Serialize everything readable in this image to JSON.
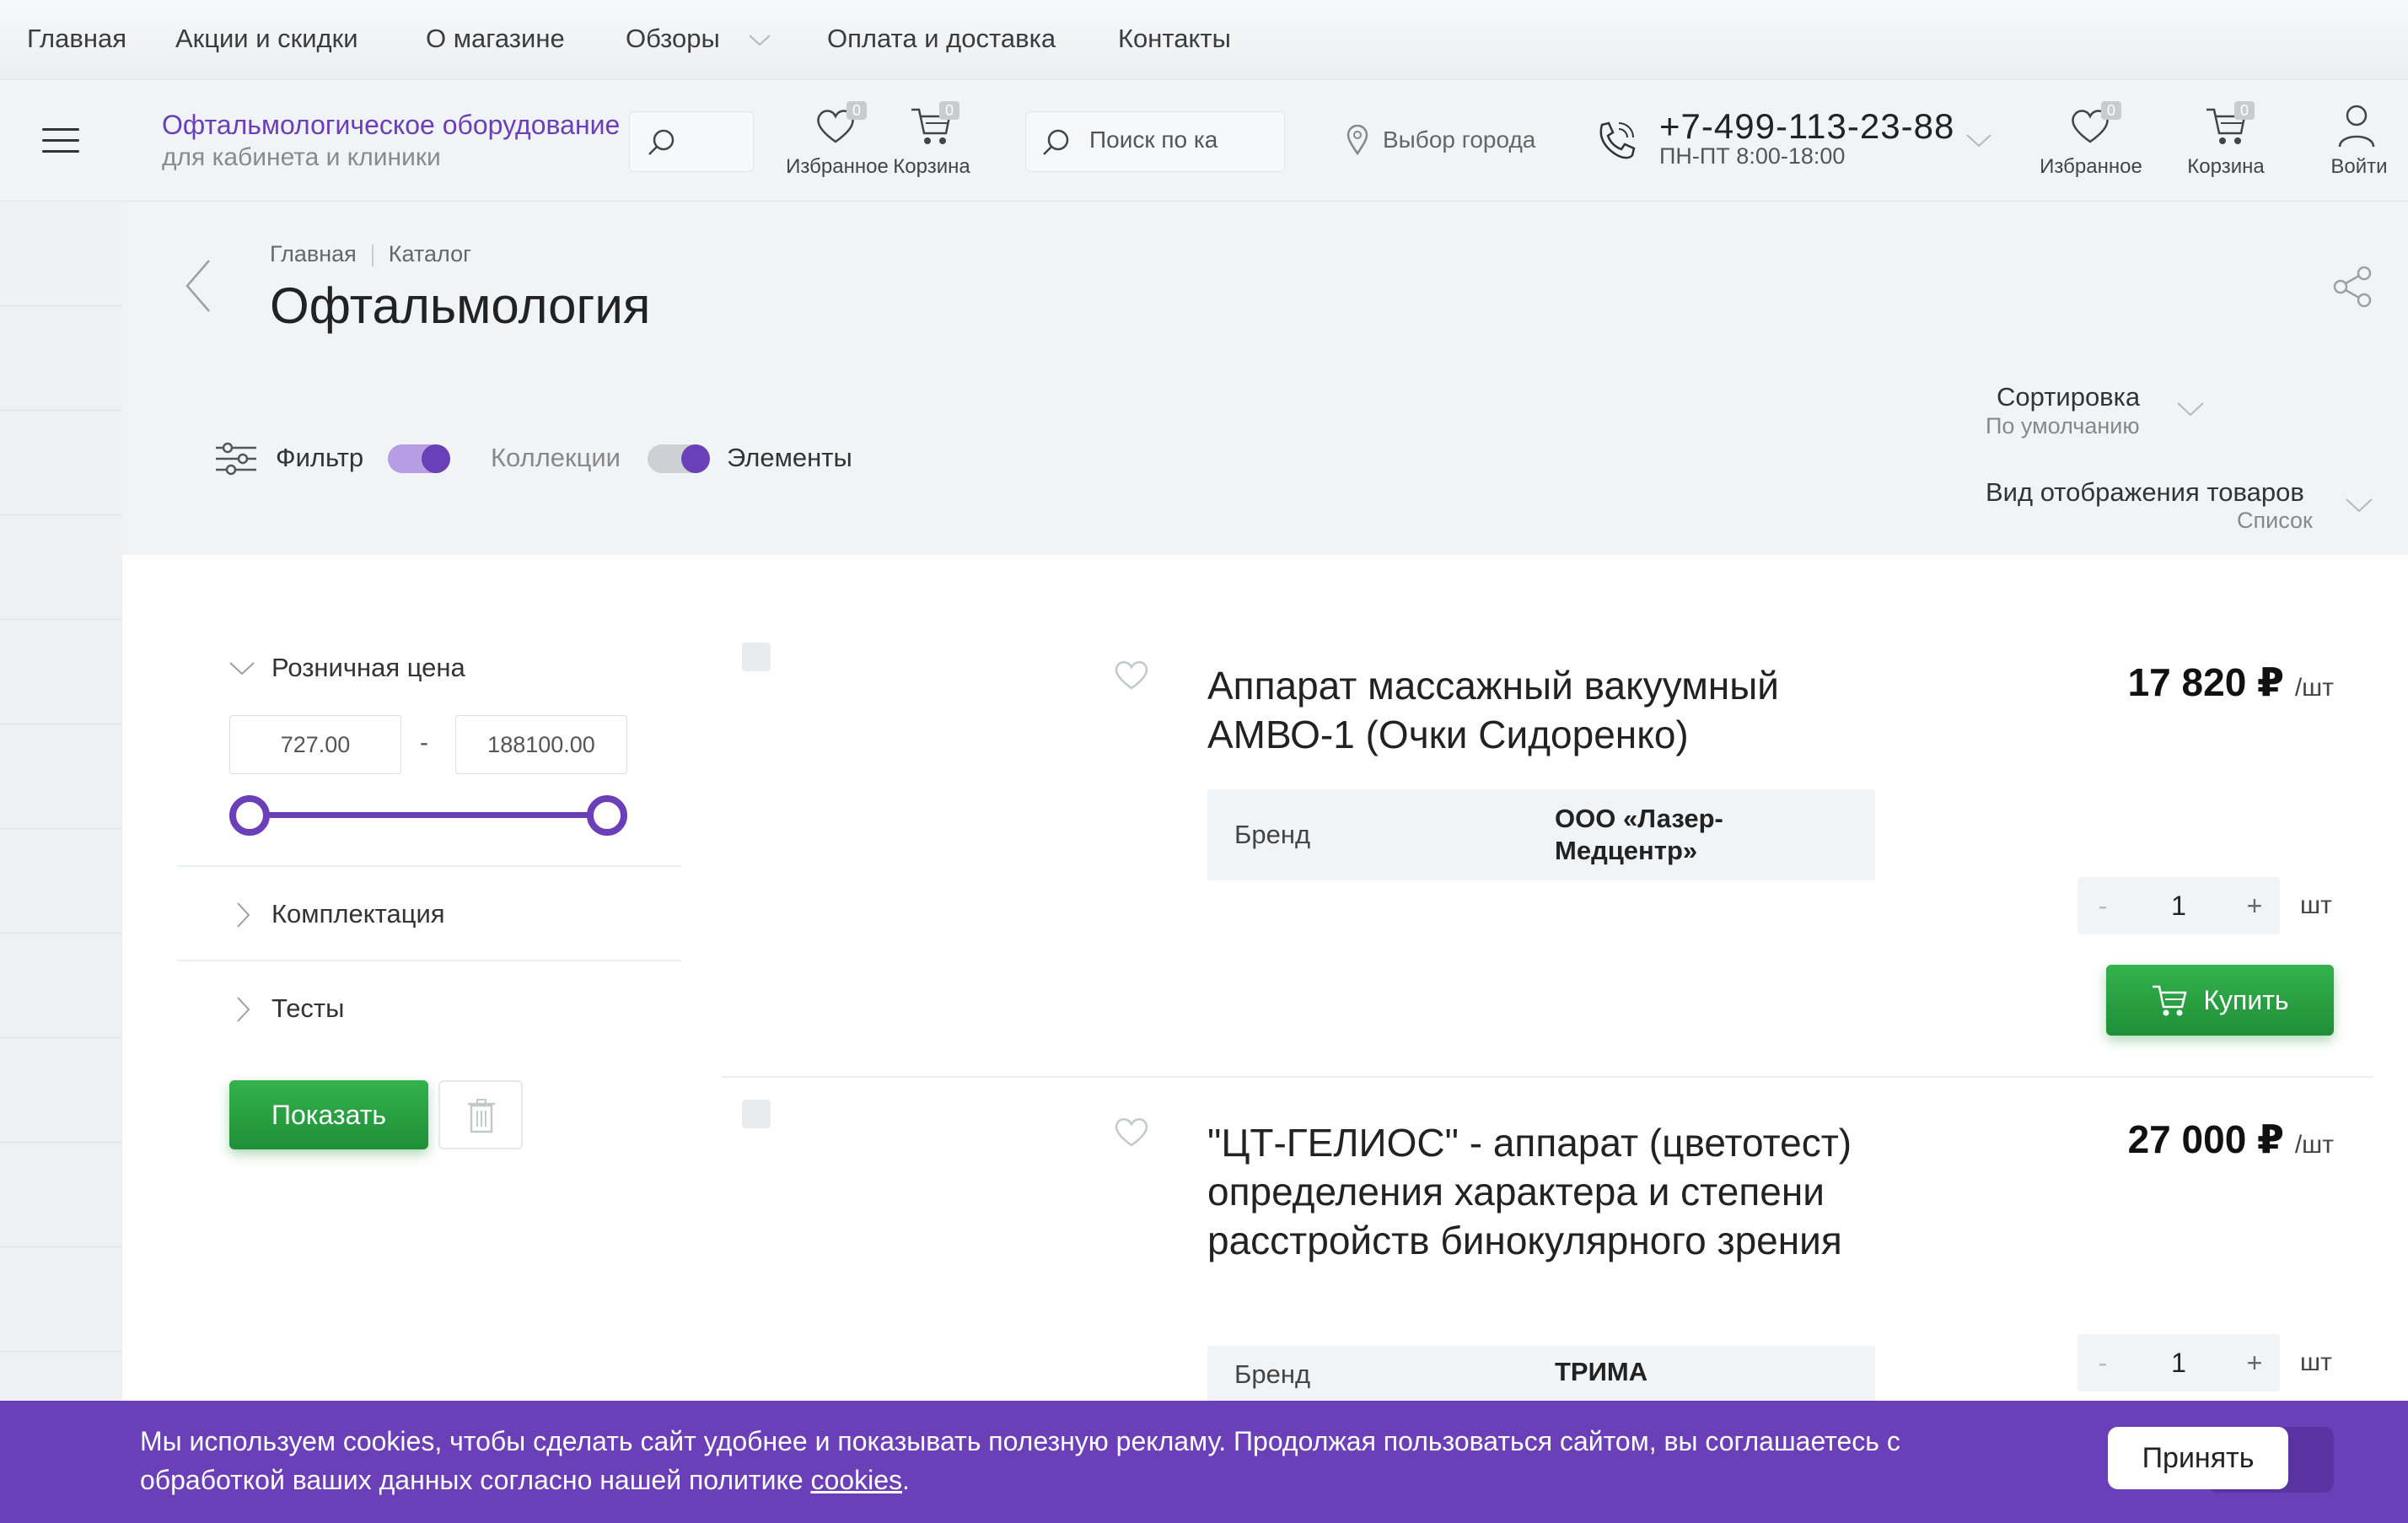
{
  "topnav": {
    "items": [
      "Главная",
      "Акции и скидки",
      "О магазине",
      "Обзоры",
      "Оплата и доставка",
      "Контакты"
    ]
  },
  "header": {
    "brand_line1": "Офтальмологическое оборудование",
    "brand_line2": "для кабинета и клиники",
    "fav_label": "Избранное",
    "cart_label": "Корзина",
    "fav_count": "0",
    "cart_count": "0",
    "search_placeholder": "Поиск по ка",
    "city": "Выбор города",
    "phone": "+7-499-113-23-88",
    "hours": "ПН-ПТ 8:00-18:00",
    "login": "Войти"
  },
  "breadcrumb": [
    "Главная",
    "Каталог"
  ],
  "page_title": "Офтальмология",
  "controls": {
    "filter": "Фильтр",
    "collections": "Коллекции",
    "elements": "Элементы"
  },
  "sort": {
    "title": "Сортировка",
    "value": "По умолчанию",
    "view_title": "Вид отображения товаров",
    "view_value": "Список"
  },
  "filter": {
    "price_title": "Розничная цена",
    "price_min": "727.00",
    "price_max": "188100.00",
    "range_sep": "-",
    "range_low_fraction": 0,
    "range_high_fraction": 1,
    "section2": "Комплектация",
    "section3": "Тесты",
    "show_button": "Показать"
  },
  "products": [
    {
      "title": "Аппарат массажный вакуумный АМВО-1 (Очки Сидоренко)",
      "price": "17 820 ₽",
      "unit": "/шт",
      "prop_key": "Бренд",
      "prop_value": "ООО «Лазер-Медцентр»",
      "qty": "1",
      "qty_unit": "шт",
      "buy": "Купить"
    },
    {
      "title": "\"ЦТ-ГЕЛИОС\" - аппарат (цветотест) определения характера и степени расстройств бинокулярного зрения",
      "price": "27 000 ₽",
      "unit": "/шт",
      "prop_key": "Бренд",
      "prop_value": "ТРИМА",
      "qty": "1",
      "qty_unit": "шт"
    }
  ],
  "qty_controls": {
    "minus": "-",
    "plus": "+"
  },
  "cookie": {
    "text": "Мы используем cookies, чтобы сделать сайт удобнее и показывать полезную рекламу. Продолжая пользоваться сайтом, вы соглашаетесь с обработкой ваших данных согласно нашей политике ",
    "link": "cookies",
    "tail": ".",
    "accept": "Принять"
  },
  "colors": {
    "accent": "#6a3fb8",
    "green": "#2aa043",
    "background": "#f1f4f6"
  }
}
